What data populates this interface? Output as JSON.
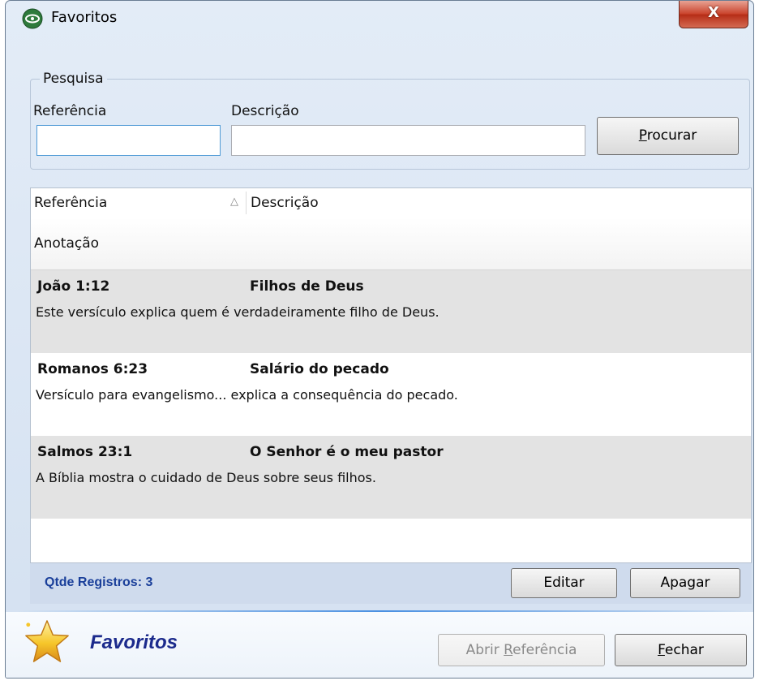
{
  "window": {
    "title": "Favoritos",
    "close_label": "X"
  },
  "search": {
    "legend": "Pesquisa",
    "ref_label": "Referência",
    "desc_label": "Descrição",
    "ref_value": "",
    "desc_value": "",
    "search_button_first": "P",
    "search_button_rest": "rocurar"
  },
  "grid": {
    "columns": [
      "Referência",
      "Descrição"
    ],
    "subheader": "Anotação",
    "sort_indicator": "△",
    "rows": [
      {
        "ref": "João 1:12",
        "desc": "Filhos de Deus",
        "note": "Este versículo explica quem é verdadeiramente filho de Deus."
      },
      {
        "ref": "Romanos 6:23",
        "desc": "Salário do pecado",
        "note": "Versículo para evangelismo... explica a consequência do pecado."
      },
      {
        "ref": "Salmos 23:1",
        "desc": "O Senhor é o meu pastor",
        "note": "A Bíblia mostra o cuidado de Deus sobre seus filhos."
      }
    ]
  },
  "footer": {
    "count_text": "Qtde Registros: 3",
    "edit_label": "Editar",
    "delete_label": "Apagar"
  },
  "bottom": {
    "brand": "Favoritos",
    "open_ref_pre": "Abrir ",
    "open_ref_ul": "R",
    "open_ref_post": "eferência",
    "close_ul": "F",
    "close_rest": "echar"
  },
  "colors": {
    "accent": "#1b2a8c",
    "count": "#1a3f9a",
    "alt_row": "#e3e3e3",
    "close": "#c9412a"
  }
}
